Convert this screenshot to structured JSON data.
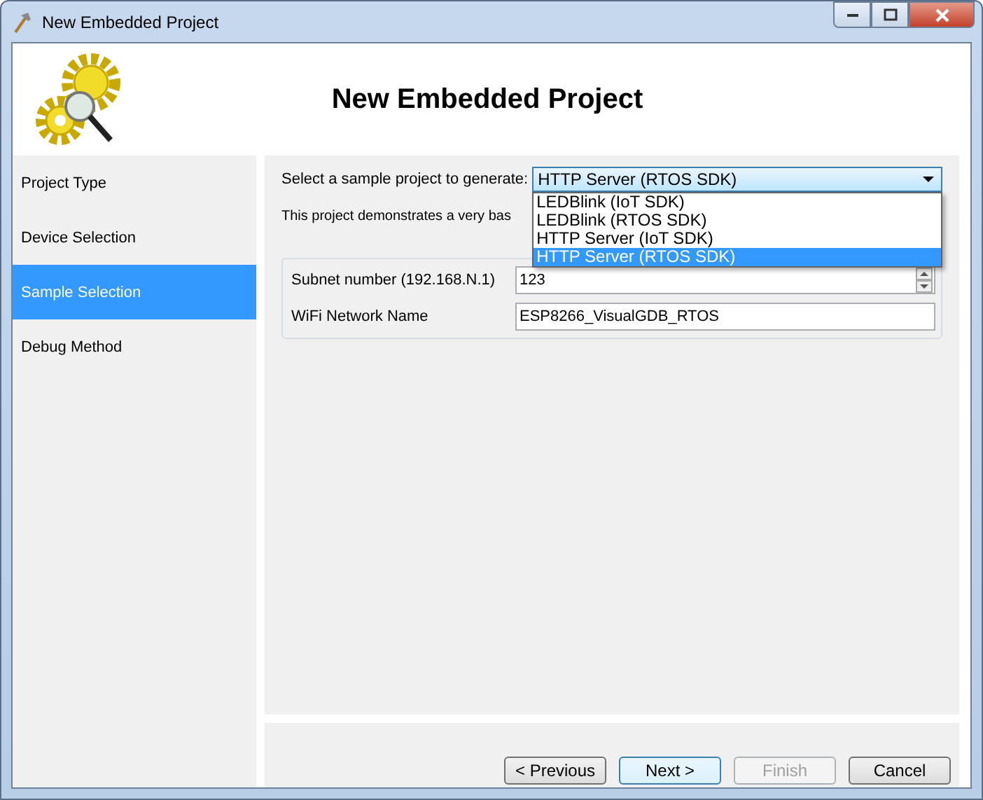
{
  "window": {
    "title": "New Embedded Project"
  },
  "header": {
    "title": "New Embedded Project"
  },
  "sidebar": {
    "items": [
      {
        "label": "Project Type",
        "selected": false
      },
      {
        "label": "Device Selection",
        "selected": false
      },
      {
        "label": "Sample Selection",
        "selected": true
      },
      {
        "label": "Debug Method",
        "selected": false
      }
    ]
  },
  "sample": {
    "label": "Select a sample project to generate:",
    "value": "HTTP Server (RTOS SDK)",
    "expanded": true,
    "options": [
      {
        "label": "LEDBlink (IoT SDK)",
        "selected": false
      },
      {
        "label": "LEDBlink (RTOS SDK)",
        "selected": false
      },
      {
        "label": "HTTP Server (IoT SDK)",
        "selected": false
      },
      {
        "label": "HTTP Server (RTOS SDK)",
        "selected": true
      }
    ],
    "description": "This project demonstrates a very bas"
  },
  "settings": [
    {
      "kind": "spin",
      "label": "Subnet number (192.168.N.1)",
      "value": "123"
    },
    {
      "kind": "text",
      "label": "WiFi Network Name",
      "value": "ESP8266_VisualGDB_RTOS"
    }
  ],
  "buttons": [
    {
      "label": "< Previous",
      "disabled": false,
      "default": false
    },
    {
      "label": "Next >",
      "disabled": false,
      "default": true
    },
    {
      "label": "Finish",
      "disabled": true,
      "default": false
    },
    {
      "label": "Cancel",
      "disabled": false,
      "default": false
    }
  ]
}
